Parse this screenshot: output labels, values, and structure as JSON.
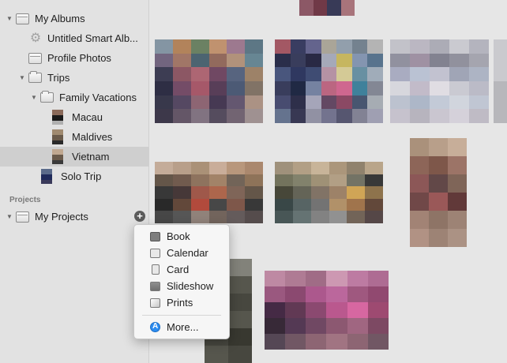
{
  "sidebar": {
    "my_albums": "My Albums",
    "smart_album": "Untitled Smart Alb...",
    "profile_photos": "Profile Photos",
    "trips": "Trips",
    "family_vacations": "Family Vacations",
    "macau": "Macau",
    "maldives": "Maldives",
    "vietnam": "Vietnam",
    "solo_trip": "Solo Trip",
    "projects_header": "Projects",
    "my_projects": "My Projects",
    "add_button": "+"
  },
  "menu": {
    "items": [
      "Book",
      "Calendar",
      "Card",
      "Slideshow",
      "Prints"
    ],
    "more": "More..."
  },
  "photos": {
    "tiles": [
      {
        "cols": 4,
        "rows": 1,
        "colors": [
          "#8a4b5c",
          "#6b2a3a",
          "#2a2c4e",
          "#a86a72"
        ]
      },
      {
        "cols": 6,
        "rows": 6,
        "colors": [
          "#7a8fa0",
          "#b37a4a",
          "#5f7a55",
          "#c28a60",
          "#9a6f8a",
          "#4f6f7f",
          "#6a5a7a",
          "#a06c5a",
          "#3d5a6a",
          "#8f5f4f",
          "#b08a70",
          "#5a7f8f",
          "#2f2f4a",
          "#8a4a5a",
          "#b05a6a",
          "#6a3a5a",
          "#4a5a7a",
          "#9a7a5a",
          "#1f1f3a",
          "#6f3f5f",
          "#a84a5f",
          "#4f2f4f",
          "#3f4f6f",
          "#7a6a5a",
          "#2a2a40",
          "#4a3a5a",
          "#8a5a6a",
          "#3a2a4a",
          "#5a4a6a",
          "#aa8a7a",
          "#2f2a3f",
          "#5a4a5f",
          "#7a6a7a",
          "#4a3f55",
          "#6a5a6a",
          "#9a8a8a"
        ]
      },
      {
        "cols": 7,
        "rows": 6,
        "colors": [
          "#a54a5a",
          "#2a2f5a",
          "#5a5a8a",
          "#a6a090",
          "#8a9aaa",
          "#6a7a8a",
          "#b0b0b0",
          "#1a1f40",
          "#2a2f55",
          "#1a1a3a",
          "#a0a4b8",
          "#c6b24a",
          "#7a8fb0",
          "#4a6a8a",
          "#3a4a7a",
          "#1f2a5a",
          "#2f3f6f",
          "#b48aa0",
          "#d4c88a",
          "#5a8aa0",
          "#9aa8b8",
          "#2a2f55",
          "#0f1a3a",
          "#6a7aa0",
          "#c05a7a",
          "#d85a8a",
          "#2a7a9a",
          "#7a8090",
          "#3a3f6a",
          "#1f2040",
          "#a0a0b8",
          "#5a3a5a",
          "#8a3a5a",
          "#3a4a6a",
          "#a0a8b0",
          "#5a6a8a",
          "#2a2a4a",
          "#8a8aa0",
          "#6a6a8a",
          "#4a4a6a",
          "#7a7a90",
          "#9a9ab0"
        ]
      },
      {
        "cols": 5,
        "rows": 6,
        "colors": [
          "#c0c0c8",
          "#b8b4c0",
          "#a8a8b4",
          "#c8c8d0",
          "#b0b0bc",
          "#8a8a9a",
          "#9a8aa0",
          "#7a7a8a",
          "#8a8a98",
          "#a0a0ac",
          "#a4a8c0",
          "#b6c0d4",
          "#c0c0d0",
          "#9aa0b4",
          "#a8b0c4",
          "#d6d6de",
          "#c0b8c8",
          "#e0dde4",
          "#c8c8d2",
          "#b8b8c6",
          "#b8c0d0",
          "#a8b4c8",
          "#c0c8d8",
          "#d0d4de",
          "#bcc4d4",
          "#c4c0cc",
          "#b4b0bc",
          "#c8c4d0",
          "#d4d0da",
          "#bcb8c4"
        ]
      },
      {
        "cols": 1,
        "rows": 2,
        "colors": [
          "#c8c8cc",
          "#b4b4b8"
        ]
      },
      {
        "cols": 6,
        "rows": 5,
        "colors": [
          "#c4a890",
          "#b89a80",
          "#a88a6a",
          "#caa890",
          "#b89070",
          "#a88060",
          "#5a4a3a",
          "#6a5040",
          "#8a6a50",
          "#a07a5a",
          "#6a5a4a",
          "#8a6a4a",
          "#2a2a2a",
          "#3a2a2a",
          "#a04a3a",
          "#b05a3a",
          "#7a5a4a",
          "#5a4a3a",
          "#1a1a1a",
          "#5a3a2a",
          "#b83a2a",
          "#3a3a3a",
          "#7a4a3a",
          "#2a2a2a",
          "#3a3a3a",
          "#4a4a4a",
          "#8a7a70",
          "#6a5a50",
          "#5a5050",
          "#4a4040"
        ]
      },
      {
        "cols": 6,
        "rows": 5,
        "colors": [
          "#9a8a70",
          "#b09a7a",
          "#c8b090",
          "#a89070",
          "#8a7a60",
          "#b8a080",
          "#6a6a50",
          "#7a7a60",
          "#9a8a6a",
          "#b09a7a",
          "#6a6a5a",
          "#2a2a2a",
          "#3a3a2a",
          "#5a5a4a",
          "#7a6a5a",
          "#9a7a5a",
          "#d4a040",
          "#8a6a3a",
          "#2a3a3a",
          "#4a5a5a",
          "#6a6a6a",
          "#b08a5a",
          "#a06a3a",
          "#5a3a2a",
          "#3a4a4a",
          "#5a6a6a",
          "#7a7a7a",
          "#8a8a8a",
          "#6a5a4a",
          "#4a3a3a"
        ]
      },
      {
        "cols": 3,
        "rows": 6,
        "colors": [
          "#a88a70",
          "#b89a80",
          "#c8aa90",
          "#8a5a4a",
          "#7a4a3a",
          "#9a6a5a",
          "#8a4a4a",
          "#5a3a3a",
          "#7a5a4a",
          "#6a3a3a",
          "#9a4a4a",
          "#5a2a2a",
          "#a07a6a",
          "#8a6a5a",
          "#9a7a6a",
          "#b08a7a",
          "#9a7a6a",
          "#a88a7a"
        ]
      },
      {
        "cols": 2,
        "rows": 6,
        "colors": [
          "#a8a4a0",
          "#7a7a70",
          "#6a6a60",
          "#4a4a40",
          "#5a5a50",
          "#3a3a30",
          "#6a6a60",
          "#4a4a40",
          "#3a3a30",
          "#2a2a20",
          "#4a4a40",
          "#3a3a30"
        ]
      },
      {
        "cols": 6,
        "rows": 5,
        "colors": [
          "#c080a0",
          "#b07090",
          "#a06080",
          "#d090b0",
          "#c070a0",
          "#b06090",
          "#9a4a7a",
          "#8a3a6a",
          "#b04a8a",
          "#c05a9a",
          "#a04a7a",
          "#903a6a",
          "#3a1a3a",
          "#5a2a4a",
          "#8a3a6a",
          "#c04a8a",
          "#e05aa0",
          "#a03a6a",
          "#2a1a2a",
          "#4a2a4a",
          "#6a3a5a",
          "#8a4a6a",
          "#a05a7a",
          "#7a3a5a",
          "#4a3a4a",
          "#6a4a5a",
          "#8a5a6a",
          "#a06a7a",
          "#8a5a6a",
          "#6a4a5a"
        ]
      }
    ]
  }
}
